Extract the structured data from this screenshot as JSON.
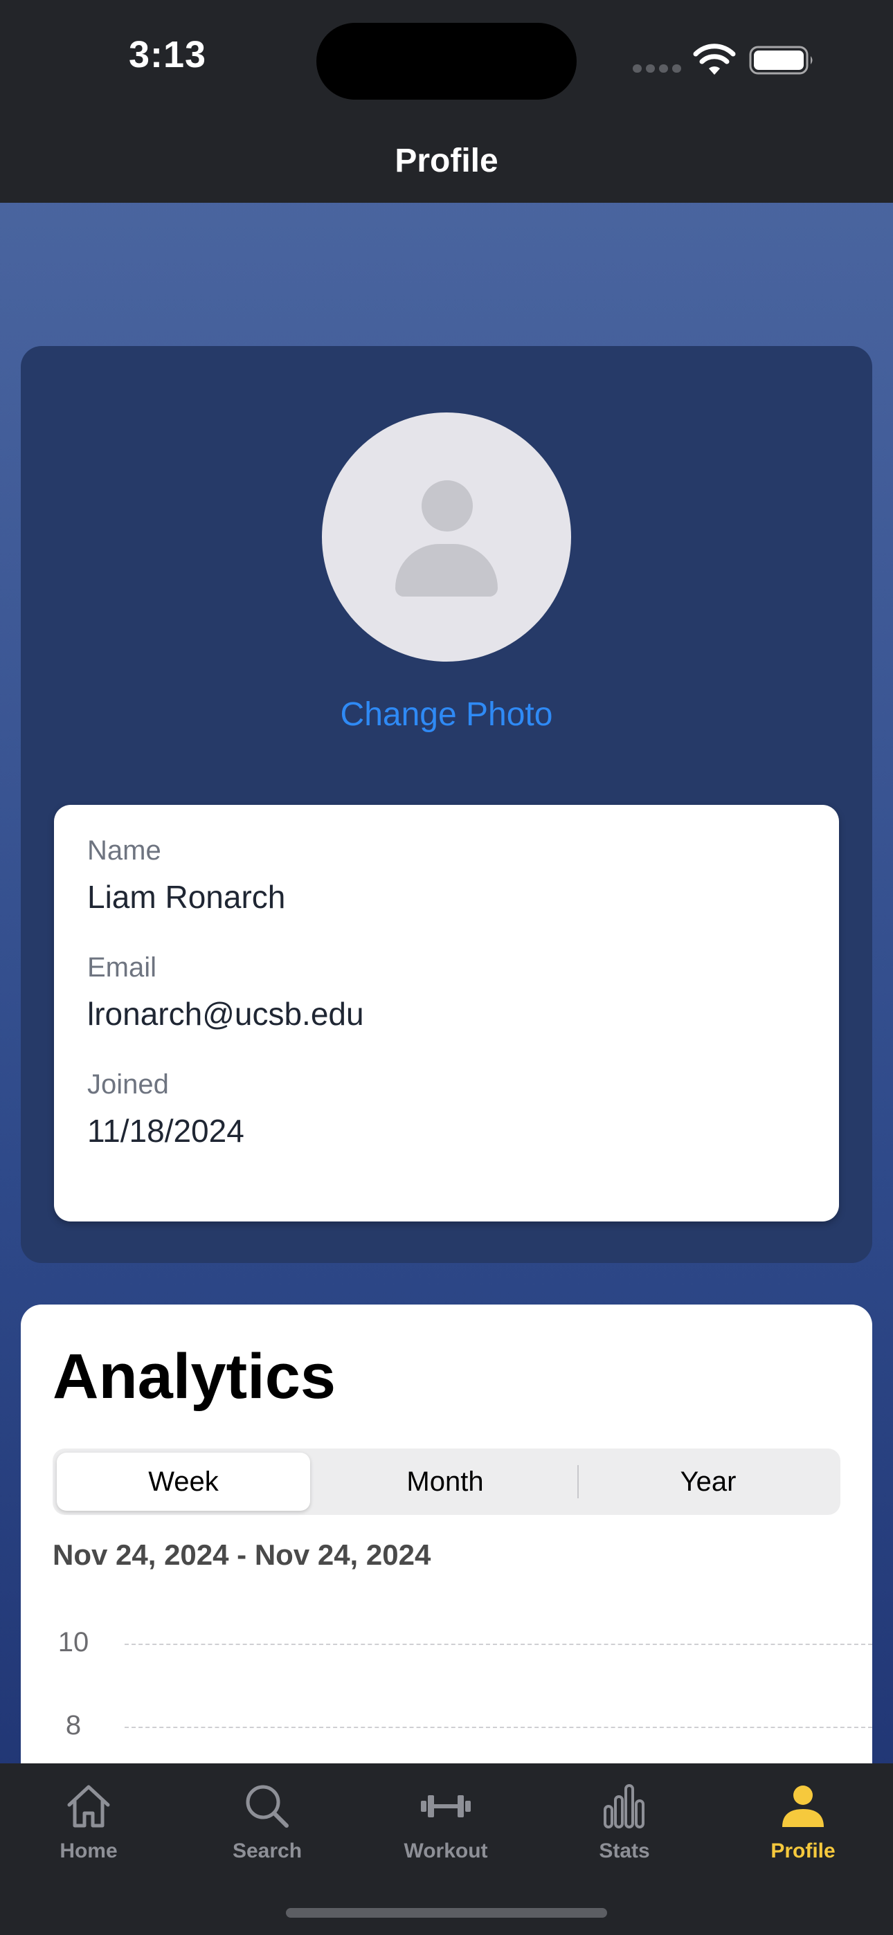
{
  "status_bar": {
    "time": "3:13"
  },
  "header": {
    "title": "Profile"
  },
  "profile": {
    "change_photo_label": "Change Photo",
    "fields": [
      {
        "label": "Name",
        "value": "Liam Ronarch"
      },
      {
        "label": "Email",
        "value": "lronarch@ucsb.edu"
      },
      {
        "label": "Joined",
        "value": "11/18/2024"
      }
    ]
  },
  "analytics": {
    "title": "Analytics",
    "segments": [
      "Week",
      "Month",
      "Year"
    ],
    "selected_segment": "Week",
    "date_range": "Nov 24, 2024 - Nov 24, 2024",
    "y_ticks": [
      "10",
      "8"
    ]
  },
  "tab_bar": {
    "items": [
      {
        "label": "Home",
        "icon": "house-icon"
      },
      {
        "label": "Search",
        "icon": "magnifier-icon"
      },
      {
        "label": "Workout",
        "icon": "dumbbell-icon"
      },
      {
        "label": "Stats",
        "icon": "bar-chart-icon"
      },
      {
        "label": "Profile",
        "icon": "person-icon"
      }
    ],
    "active": "Profile"
  },
  "colors": {
    "accent_active_tab": "#f6c93d",
    "link_blue": "#2f8af5",
    "bar_background": "#232529",
    "card_background": "#263a68"
  }
}
